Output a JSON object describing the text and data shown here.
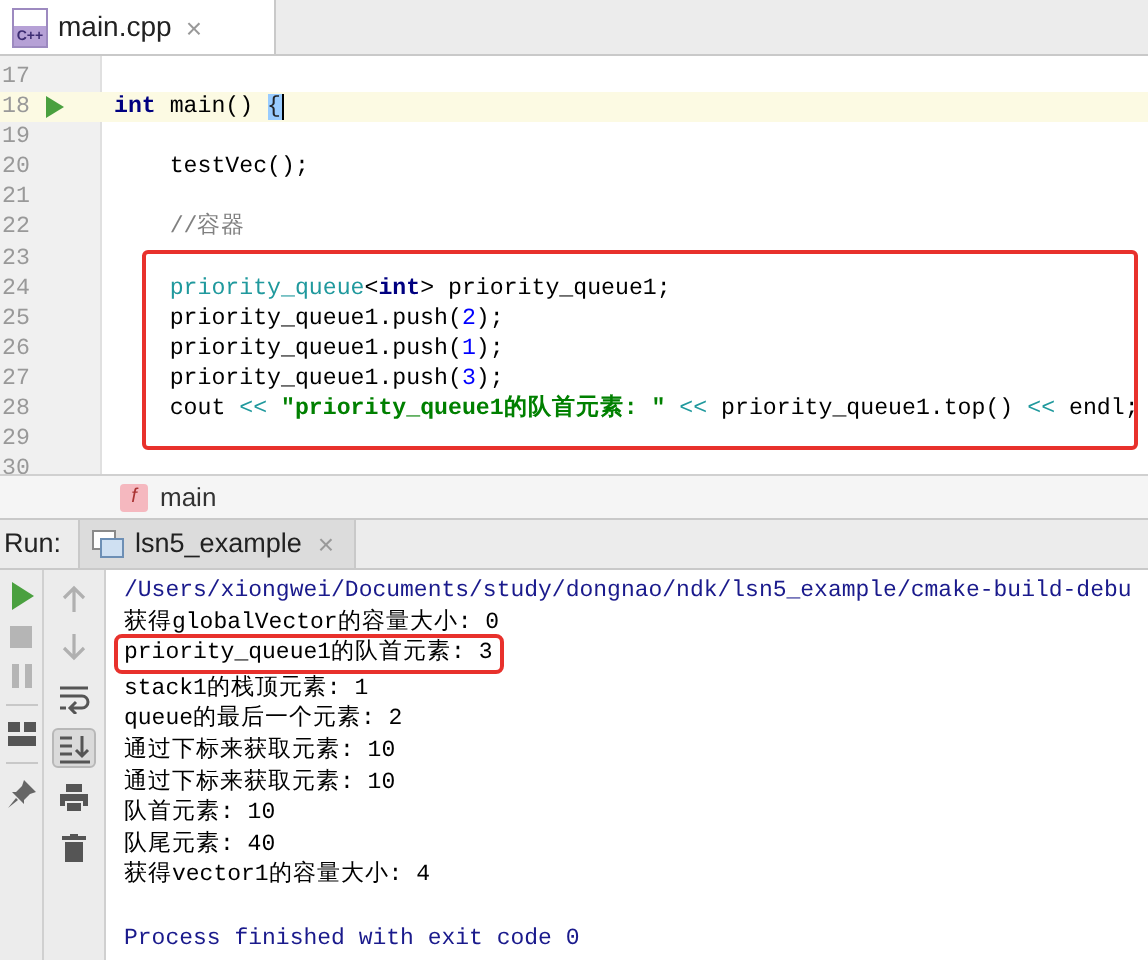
{
  "editor_tab": {
    "label": "main.cpp",
    "icon_label": "C++",
    "close": "×",
    "selected": true
  },
  "code_blocks": [
    {
      "framed": false,
      "lines": [
        {
          "number": "17",
          "current": false,
          "runnable": false
        },
        {
          "number": "18",
          "current": true,
          "runnable": true,
          "tokens": [
            {
              "text": "int",
              "kind": "keyword"
            },
            {
              "text": " main() ",
              "kind": "plain"
            },
            {
              "text": "{",
              "kind": "match"
            }
          ]
        },
        {
          "number": "19",
          "current": false,
          "runnable": false
        },
        {
          "number": "20",
          "current": false,
          "runnable": false,
          "tokens": [
            {
              "text": "    testVec();",
              "kind": "plain"
            }
          ]
        },
        {
          "number": "21",
          "current": false,
          "runnable": false
        },
        {
          "number": "22",
          "current": false,
          "runnable": false,
          "tokens": [
            {
              "text": "    //容器",
              "kind": "comment"
            }
          ]
        }
      ]
    },
    {
      "framed": true,
      "lines": [
        {
          "number": "23",
          "current": false,
          "runnable": false
        },
        {
          "number": "24",
          "current": false,
          "runnable": false,
          "tokens": [
            {
              "text": "    priority_queue",
              "kind": "type"
            },
            {
              "text": "<",
              "kind": "plain"
            },
            {
              "text": "int",
              "kind": "keyword"
            },
            {
              "text": "> priority_queue1;",
              "kind": "plain"
            }
          ]
        },
        {
          "number": "25",
          "current": false,
          "runnable": false,
          "tokens": [
            {
              "text": "    priority_queue1.push(",
              "kind": "plain"
            },
            {
              "text": "2",
              "kind": "number"
            },
            {
              "text": ");",
              "kind": "plain"
            }
          ]
        },
        {
          "number": "26",
          "current": false,
          "runnable": false,
          "tokens": [
            {
              "text": "    priority_queue1.push(",
              "kind": "plain"
            },
            {
              "text": "1",
              "kind": "number"
            },
            {
              "text": ");",
              "kind": "plain"
            }
          ]
        },
        {
          "number": "27",
          "current": false,
          "runnable": false,
          "tokens": [
            {
              "text": "    priority_queue1.push(",
              "kind": "plain"
            },
            {
              "text": "3",
              "kind": "number"
            },
            {
              "text": ");",
              "kind": "plain"
            }
          ]
        },
        {
          "number": "28",
          "current": false,
          "runnable": false,
          "tokens": [
            {
              "text": "    cout ",
              "kind": "plain"
            },
            {
              "text": "<<",
              "kind": "operator"
            },
            {
              "text": " \"priority_queue1的队首元素: \" ",
              "kind": "string"
            },
            {
              "text": "<<",
              "kind": "operator"
            },
            {
              "text": " priority_queue1.top() ",
              "kind": "plain"
            },
            {
              "text": "<<",
              "kind": "operator"
            },
            {
              "text": " endl;",
              "kind": "plain"
            }
          ]
        },
        {
          "number": "29",
          "current": false,
          "runnable": false
        }
      ]
    },
    {
      "framed": false,
      "lines": [
        {
          "number": "30",
          "current": false,
          "runnable": false
        }
      ]
    }
  ],
  "breadcrumb": {
    "icon_label": "f",
    "label": "main"
  },
  "run_panel": {
    "title": "Run:",
    "tab": {
      "label": "lsn5_example",
      "close": "×",
      "selected": true
    },
    "console": [
      {
        "text": "/Users/xiongwei/Documents/study/dongnao/ndk/lsn5_example/cmake-build-debu",
        "kind": "path",
        "boxed": false
      },
      {
        "text": "获得globalVector的容量大小: 0",
        "kind": "output",
        "boxed": false
      },
      {
        "text": "priority_queue1的队首元素: 3",
        "kind": "output",
        "boxed": true
      },
      {
        "text": "stack1的栈顶元素: 1",
        "kind": "output",
        "boxed": false
      },
      {
        "text": "queue的最后一个元素: 2",
        "kind": "output",
        "boxed": false
      },
      {
        "text": "通过下标来获取元素: 10",
        "kind": "output",
        "boxed": false
      },
      {
        "text": "通过下标来获取元素: 10",
        "kind": "output",
        "boxed": false
      },
      {
        "text": "队首元素: 10",
        "kind": "output",
        "boxed": false
      },
      {
        "text": "队尾元素: 40",
        "kind": "output",
        "boxed": false
      },
      {
        "text": "获得vector1的容量大小: 4",
        "kind": "output",
        "boxed": false
      },
      {
        "text": "Process finished with exit code 0",
        "kind": "exit",
        "boxed": false
      }
    ],
    "scroll_to_end_on": true
  }
}
